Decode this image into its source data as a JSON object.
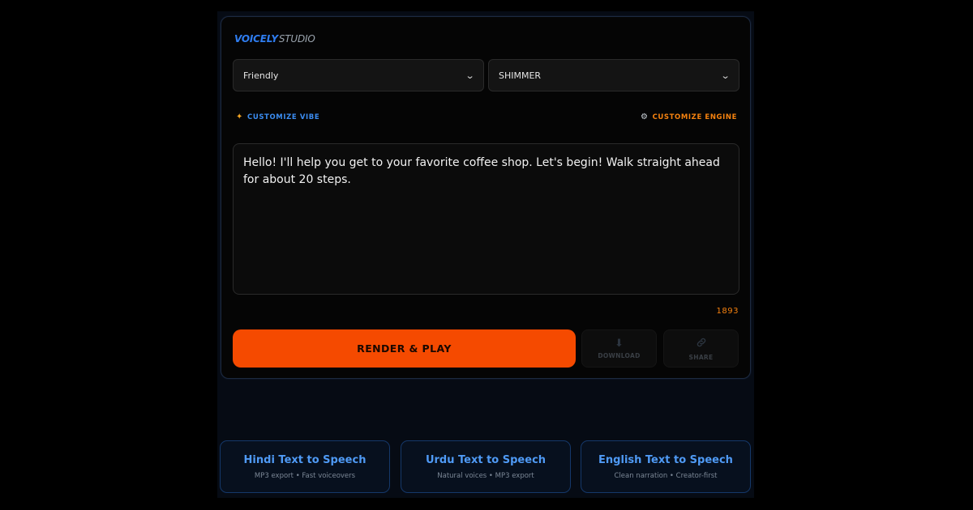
{
  "brand": {
    "primary": "VOICELY",
    "secondary": "STUDIO"
  },
  "controls": {
    "vibe_select": {
      "value": "Friendly"
    },
    "engine_select": {
      "value": "SHIMMER"
    },
    "customize_vibe": "CUSTOMIZE VIBE",
    "customize_engine": "CUSTOMIZE ENGINE"
  },
  "editor": {
    "text": "Hello! I'll help you get to your favorite coffee shop. Let's begin! Walk straight ahead for about 20 steps.",
    "char_count": "1893"
  },
  "actions": {
    "render_label": "RENDER & PLAY",
    "download_label": "DOWNLOAD",
    "share_label": "SHARE"
  },
  "tiles": [
    {
      "title": "Hindi Text to Speech",
      "subtitle": "MP3 export • Fast voiceovers"
    },
    {
      "title": "Urdu Text to Speech",
      "subtitle": "Natural voices • MP3 export"
    },
    {
      "title": "English Text to Speech",
      "subtitle": "Clean narration • Creator-first"
    }
  ],
  "icons": {
    "customize_vibe": "sparkle-icon",
    "customize_engine": "gear-icon",
    "download": "download-icon",
    "share": "link-icon",
    "select": "chevron-down-icon"
  },
  "colors": {
    "accent_orange": "#f54a00",
    "brand_blue": "#2f7df0",
    "link_orange": "#f5820f",
    "tile_blue": "#4f9af5"
  }
}
